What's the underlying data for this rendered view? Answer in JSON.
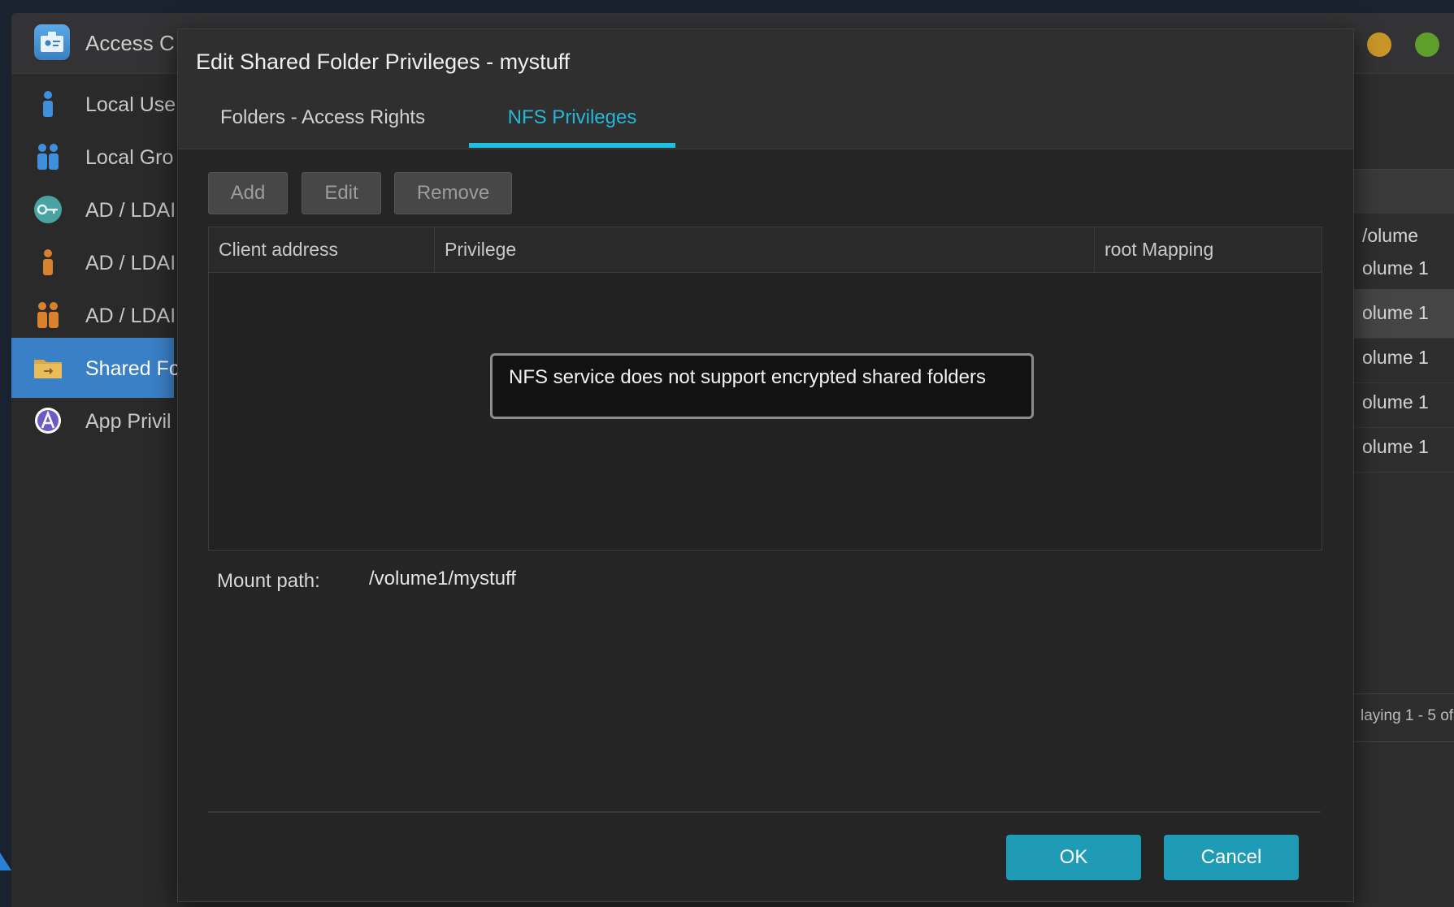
{
  "app": {
    "title": "Access C",
    "sidebar": [
      {
        "label": "Local Use",
        "icon": "user-icon"
      },
      {
        "label": "Local Gro",
        "icon": "group-icon"
      },
      {
        "label": "AD / LDAI",
        "icon": "key-icon"
      },
      {
        "label": "AD / LDAI",
        "icon": "user-icon"
      },
      {
        "label": "AD / LDAI",
        "icon": "group-icon"
      },
      {
        "label": "Shared Fo",
        "icon": "folder-icon"
      },
      {
        "label": "App Privil",
        "icon": "app-icon"
      }
    ],
    "right_panel": {
      "column_header": "/olume",
      "rows": [
        "olume 1",
        "olume 1",
        "olume 1",
        "olume 1",
        "olume 1"
      ],
      "footer": "laying 1 - 5 of"
    }
  },
  "dialog": {
    "title": "Edit Shared Folder Privileges - mystuff",
    "tabs": [
      {
        "label": "Folders - Access Rights"
      },
      {
        "label": "NFS Privileges"
      }
    ],
    "toolbar": {
      "add": "Add",
      "edit": "Edit",
      "remove": "Remove"
    },
    "grid": {
      "columns": [
        "Client address",
        "Privilege",
        "root Mapping"
      ],
      "notice": "NFS service does not support encrypted shared folders"
    },
    "mount": {
      "label": "Mount path:",
      "value": "/volume1/mystuff"
    },
    "ok": "OK",
    "cancel": "Cancel"
  },
  "colors": {
    "accent": "#1ec0e0",
    "primary_button": "#1f9bb5",
    "sidebar_active": "#3a80c7"
  }
}
